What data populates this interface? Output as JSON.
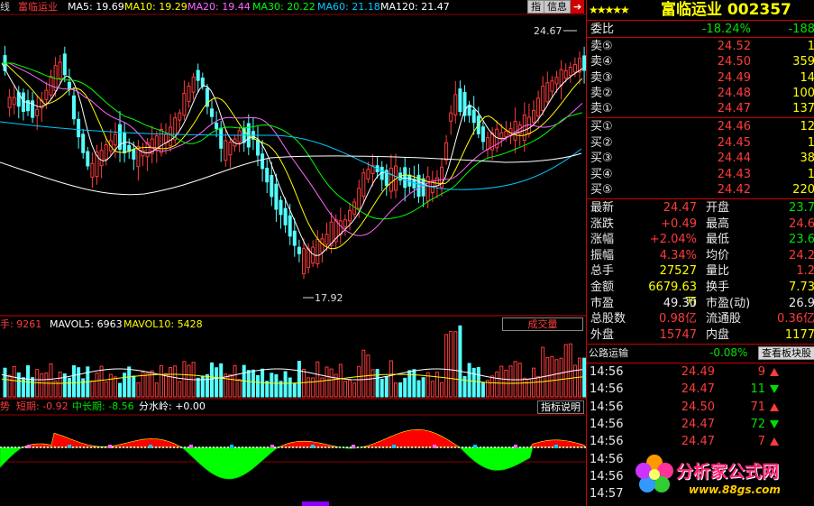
{
  "ma_bar": {
    "prefix": "线",
    "name": "富临运业",
    "ma5": "MA5: 19.69",
    "ma10": "MA10: 19.29",
    "ma20": "MA20: 19.44",
    "ma30": "MA30: 20.22",
    "ma60": "MA60: 21.18",
    "ma120": "MA120: 21.47",
    "btn_indicator": "指",
    "btn_info": "信息",
    "colors": {
      "ma5": "#ffffff",
      "ma10": "#ffff00",
      "ma20": "#ff66ff",
      "ma30": "#00ff00",
      "ma60": "#00c8ff",
      "ma120": "#ffffff"
    }
  },
  "price_chart": {
    "high_label": "24.67",
    "low_label": "17.92"
  },
  "volume_bar": {
    "current": "手: 9261",
    "mavol5": "MAVOL5: 6963",
    "mavol10": "MAVOL10: 5428",
    "select_label": "成交量"
  },
  "indicator_bar": {
    "name": "势",
    "short": "短期: -0.92",
    "mid": "中长期: -8.56",
    "water": "分水岭: +0.00",
    "help_button": "指标说明"
  },
  "quote": {
    "stars": "★★★★★",
    "title": "富临运业 002357",
    "weibi_label": "委比",
    "weibi_value": "-18.24%",
    "weibi_right": "-188",
    "asks": [
      {
        "label": "卖⑤",
        "price": "24.52",
        "vol": "1"
      },
      {
        "label": "卖④",
        "price": "24.50",
        "vol": "359"
      },
      {
        "label": "卖③",
        "price": "24.49",
        "vol": "14"
      },
      {
        "label": "卖②",
        "price": "24.48",
        "vol": "100"
      },
      {
        "label": "卖①",
        "price": "24.47",
        "vol": "137"
      }
    ],
    "bids": [
      {
        "label": "买①",
        "price": "24.46",
        "vol": "12"
      },
      {
        "label": "买②",
        "price": "24.45",
        "vol": "1"
      },
      {
        "label": "买③",
        "price": "24.44",
        "vol": "38"
      },
      {
        "label": "买④",
        "price": "24.43",
        "vol": "1"
      },
      {
        "label": "买⑤",
        "price": "24.42",
        "vol": "220"
      }
    ],
    "stats": [
      {
        "l1": "最新",
        "v1": "24.47",
        "l2": "开盘",
        "v2": "23.7"
      },
      {
        "l1": "涨跌",
        "v1": "+0.49",
        "l2": "最高",
        "v2": "24.6"
      },
      {
        "l1": "涨幅",
        "v1": "+2.04%",
        "l2": "最低",
        "v2": "23.6"
      },
      {
        "l1": "振幅",
        "v1": "4.34%",
        "l2": "均价",
        "v2": "24.2"
      },
      {
        "l1": "总手",
        "v1": "27527",
        "l2": "量比",
        "v2": "1.2"
      },
      {
        "l1": "金额",
        "v1": "6679.63万",
        "l2": "换手",
        "v2": "7.73"
      },
      {
        "l1": "市盈",
        "v1": "49.30",
        "l2": "市盈(动)",
        "v2": "26.9"
      },
      {
        "l1": "总股数",
        "v1": "0.98亿",
        "l2": "流通股",
        "v2": "0.36亿"
      },
      {
        "l1": "外盘",
        "v1": "15747",
        "l2": "内盘",
        "v2": "1177"
      }
    ],
    "sector_label": "公路运输",
    "sector_change": "-0.08%",
    "sector_button": "查看板块股",
    "ticks": [
      {
        "time": "14:56",
        "price": "24.49",
        "vol": "9",
        "dir": "up"
      },
      {
        "time": "14:56",
        "price": "24.47",
        "vol": "11",
        "dir": "down"
      },
      {
        "time": "14:56",
        "price": "24.50",
        "vol": "71",
        "dir": "up"
      },
      {
        "time": "14:56",
        "price": "24.47",
        "vol": "72",
        "dir": "down"
      },
      {
        "time": "14:56",
        "price": "24.47",
        "vol": "7",
        "dir": "up"
      },
      {
        "time": "14:56",
        "price": "",
        "vol": "",
        "dir": ""
      },
      {
        "time": "14:56",
        "price": "",
        "vol": "",
        "dir": ""
      },
      {
        "time": "14:57",
        "price": "",
        "vol": "",
        "dir": ""
      }
    ]
  },
  "watermark": {
    "title": "分析家公式网",
    "url": "www.88gs.com"
  }
}
